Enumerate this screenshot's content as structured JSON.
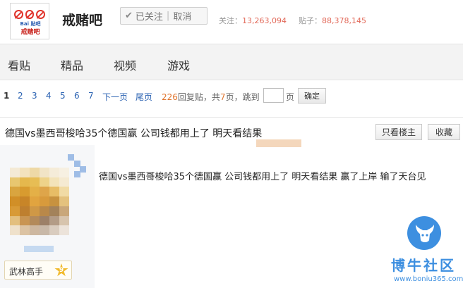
{
  "header": {
    "logo": {
      "brand": "Bai 贴吧",
      "name": "戒赌吧"
    },
    "forum_title": "戒赌吧",
    "follow_label": "已关注",
    "cancel_label": "取消",
    "stats": {
      "follow_label": "关注：",
      "follow_count": "13,263,094",
      "post_label": "贴子：",
      "post_count": "88,378,145"
    }
  },
  "nav": {
    "items": [
      {
        "label": "看贴"
      },
      {
        "label": "精品"
      },
      {
        "label": "视频"
      },
      {
        "label": "游戏"
      }
    ]
  },
  "pager": {
    "pages": [
      "1",
      "2",
      "3",
      "4",
      "5",
      "6",
      "7"
    ],
    "current": "1",
    "next_label": "下一页",
    "last_label": "尾页",
    "reply_count": "226",
    "reply_suffix": "回复贴，共",
    "page_total": "7",
    "page_total_suffix": "页，跳到",
    "page_unit": "页",
    "confirm_label": "确定"
  },
  "thread": {
    "title": "德国vs墨西哥梭哈35个德国赢 公司钱都用上了 明天看结果",
    "only_owner_label": "只看楼主",
    "collect_label": "收藏"
  },
  "post": {
    "author_rank": "武林高手",
    "author_level": "9",
    "body": "德国vs墨西哥梭哈35个德国赢 公司钱都用上了 明天看结果 赢了上岸 输了天台见"
  },
  "watermark": {
    "text": "博牛社区",
    "url": "www.boniu365.com"
  },
  "colors": {
    "link_blue": "#2d64b3",
    "stat_red": "#e26a5a",
    "reply_orange": "#e0742d",
    "watermark_blue": "#3d8fe0",
    "badge_gold": "#f1ba2d"
  },
  "icons": {
    "logo_icons": [
      "no-gambling-icon",
      "no-gambling-icon",
      "no-gambling-icon"
    ],
    "follow_check": "check-icon",
    "rank_level": "star-badge-icon",
    "watermark_logo": "bull-head-icon"
  }
}
